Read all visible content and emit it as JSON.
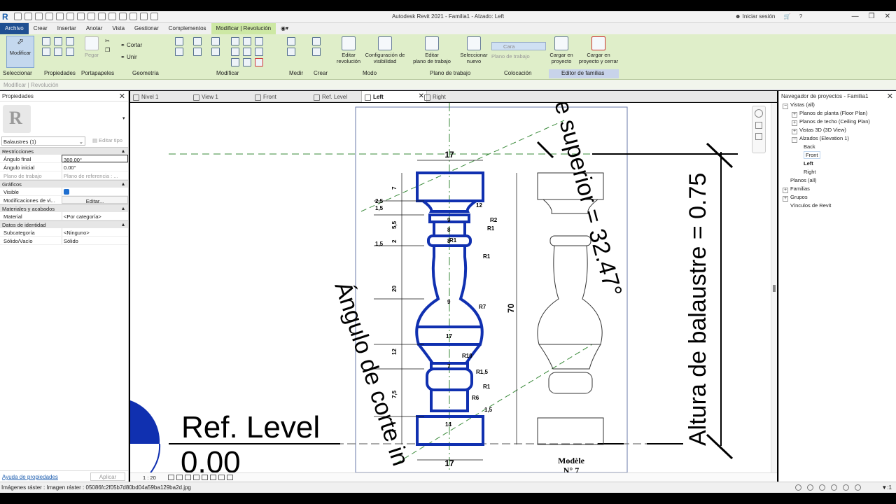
{
  "app": {
    "title": "Autodesk Revit 2021 - Familia1 - Alzado: Left",
    "login": "Iniciar sesión",
    "logo": "R"
  },
  "menu": {
    "tabs": [
      "Archivo",
      "Crear",
      "Insertar",
      "Anotar",
      "Vista",
      "Gestionar",
      "Complementos",
      "Modificar | Revolución"
    ]
  },
  "ribbon": {
    "modify_label": "Modificar",
    "paste_label": "Pegar",
    "cut_label": "Cortar",
    "join_label": "Unir",
    "edit_revolve": "Editar\nrevolución",
    "visibility_settings": "Configuración de\nvisibilidad",
    "edit_workplane": "Editar\nplano de trabajo",
    "select_new": "Seleccionar\nnuevo",
    "face_label": "Cara",
    "workplane_label": "Plano de trabajo",
    "load_project": "Cargar en\nproyecto",
    "load_project_close": "Cargar en\nproyecto y cerrar",
    "panels": [
      "Seleccionar",
      "Propiedades",
      "Portapapeles",
      "Geometría",
      "Modificar",
      "Medir",
      "Crear",
      "Modo",
      "Plano de trabajo",
      "Colocación",
      "Editor de familias"
    ]
  },
  "context_bar": "Modificar | Revolución",
  "properties": {
    "title": "Propiedades",
    "type_name": "Balaustres (1)",
    "edit_type": "Editar tipo",
    "groups": [
      {
        "name": "Restricciones",
        "rows": [
          {
            "k": "Ángulo final",
            "v": "360.00°"
          },
          {
            "k": "Ángulo inicial",
            "v": "0.00°"
          },
          {
            "k": "Plano de trabajo",
            "v": "Plano de referencia : ..."
          }
        ]
      },
      {
        "name": "Gráficos",
        "rows": [
          {
            "k": "Visible",
            "v": ""
          },
          {
            "k": "Modificaciones de vi...",
            "v": "Editar..."
          }
        ]
      },
      {
        "name": "Materiales y acabados",
        "rows": [
          {
            "k": "Material",
            "v": "<Por categoría>"
          }
        ]
      },
      {
        "name": "Datos de identidad",
        "rows": [
          {
            "k": "Subcategoría",
            "v": "<Ninguno>"
          },
          {
            "k": "Sólido/Vacío",
            "v": "Sólido"
          }
        ]
      }
    ],
    "help_link": "Ayuda de propiedades",
    "apply": "Aplicar"
  },
  "view_tabs": [
    "Nivel 1",
    "View 1",
    "Front",
    "Ref. Level",
    "Left",
    "Right"
  ],
  "drawing": {
    "ref_level": "Ref. Level",
    "ref_elev": "0.00",
    "angle_top": "e superior = 32.47°",
    "angle_cut": "Ángulo de corte in",
    "height": "Altura de balaustre = 0.75",
    "model_label": "Modèle",
    "model_no": "N° 7",
    "dim_top": "17",
    "dim_bottom": "17",
    "dim_height": "70",
    "dims_left": [
      "7",
      "2,5",
      "1,5",
      "5,5",
      "2",
      "1,5",
      "20",
      "12",
      "7,5",
      "7"
    ],
    "inner_labels": [
      "12",
      "9",
      "8",
      "8",
      "9",
      "17",
      "7",
      "14"
    ],
    "radii": [
      "R2",
      "R1",
      "R1",
      "R1",
      "R7",
      "R10",
      "R1,5",
      "R1",
      "R6",
      "1,5"
    ]
  },
  "view_status": {
    "scale": "1 : 20"
  },
  "navigator": {
    "title": "Navegador de proyectos - Familia1",
    "nodes": [
      {
        "label": "Vistas (all)",
        "level": 0,
        "toggle": "−"
      },
      {
        "label": "Planos de planta (Floor Plan)",
        "level": 1,
        "toggle": "+"
      },
      {
        "label": "Planos de techo (Ceiling Plan)",
        "level": 1,
        "toggle": "+"
      },
      {
        "label": "Vistas 3D (3D View)",
        "level": 1,
        "toggle": "+"
      },
      {
        "label": "Alzados (Elevation 1)",
        "level": 1,
        "toggle": "−"
      },
      {
        "label": "Back",
        "level": 2,
        "toggle": ""
      },
      {
        "label": "Front",
        "level": 2,
        "toggle": ""
      },
      {
        "label": "Left",
        "level": 2,
        "toggle": ""
      },
      {
        "label": "Right",
        "level": 2,
        "toggle": ""
      },
      {
        "label": "Planos (all)",
        "level": 0,
        "toggle": ""
      },
      {
        "label": "Familias",
        "level": 0,
        "toggle": "+"
      },
      {
        "label": "Grupos",
        "level": 0,
        "toggle": "+"
      },
      {
        "label": "Vínculos de Revit",
        "level": 0,
        "toggle": ""
      }
    ]
  },
  "statusbar": {
    "message": "Imágenes ráster : Imagen ráster : 05086fc2f05b7d80bd04a59ba129ba2d.jpg",
    "filter": ":1"
  },
  "colors": {
    "accent": "#1f4f91",
    "revolve_blue": "#1030b0",
    "ribbon": "#dfeec9"
  }
}
